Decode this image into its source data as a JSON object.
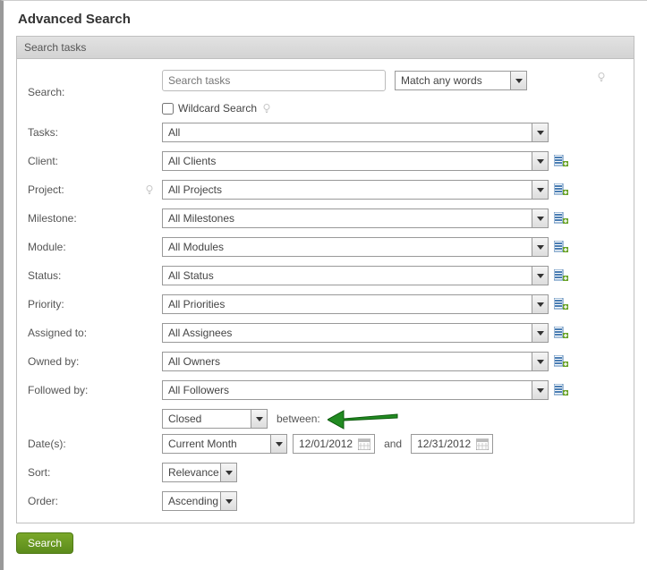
{
  "title": "Advanced Search",
  "panelHeader": "Search tasks",
  "search": {
    "label": "Search:",
    "placeholder": "Search tasks",
    "matchMode": "Match any words",
    "wildcardLabel": "Wildcard Search",
    "wildcardChecked": false
  },
  "filters": {
    "tasks": {
      "label": "Tasks:",
      "value": "All"
    },
    "client": {
      "label": "Client:",
      "value": "All Clients"
    },
    "project": {
      "label": "Project:",
      "value": "All Projects"
    },
    "milestone": {
      "label": "Milestone:",
      "value": "All Milestones"
    },
    "module": {
      "label": "Module:",
      "value": "All Modules"
    },
    "status": {
      "label": "Status:",
      "value": "All Status"
    },
    "priority": {
      "label": "Priority:",
      "value": "All Priorities"
    },
    "assigned": {
      "label": "Assigned to:",
      "value": "All Assignees"
    },
    "owned": {
      "label": "Owned by:",
      "value": "All Owners"
    },
    "followed": {
      "label": "Followed by:",
      "value": "All Followers"
    }
  },
  "dates": {
    "label": "Date(s):",
    "field": "Closed",
    "operator": "between:",
    "range": "Current Month",
    "from": "12/01/2012",
    "fromTo": "and",
    "to": "12/31/2012"
  },
  "sort": {
    "label": "Sort:",
    "value": "Relevance"
  },
  "order": {
    "label": "Order:",
    "value": "Ascending"
  },
  "searchButton": "Search"
}
